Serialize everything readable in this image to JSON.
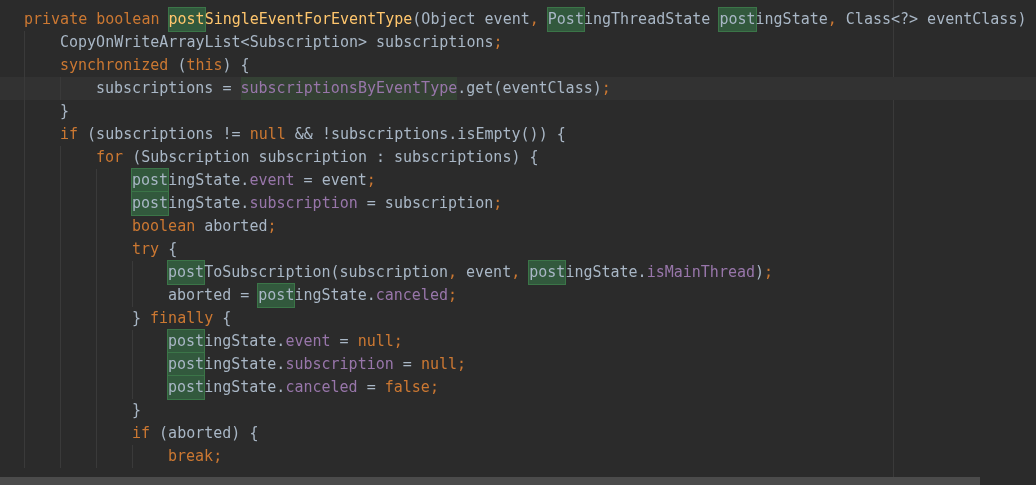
{
  "editor": {
    "lines": [
      {
        "tokens": [
          {
            "text": "private boolean ",
            "kind": "keyword"
          },
          {
            "text": "post",
            "kind": "method",
            "search_match": true
          },
          {
            "text": "SingleEventForEventType",
            "kind": "method"
          },
          {
            "text": "(Object event",
            "kind": "plain"
          },
          {
            "text": ", ",
            "kind": "punct"
          },
          {
            "text": "Post",
            "kind": "plain",
            "search_match": true
          },
          {
            "text": "ingThreadState ",
            "kind": "plain"
          },
          {
            "text": "post",
            "kind": "plain",
            "search_match": true
          },
          {
            "text": "ingState",
            "kind": "plain"
          },
          {
            "text": ", ",
            "kind": "punct"
          },
          {
            "text": "Class<?> eventClass)",
            "kind": "plain"
          }
        ],
        "children": [
          {
            "tokens": [
              {
                "text": "CopyOnWriteArrayList<Subscription> subscriptions",
                "kind": "plain"
              },
              {
                "text": ";",
                "kind": "punct"
              }
            ]
          },
          {
            "tokens": [
              {
                "text": "synchronized ",
                "kind": "keyword"
              },
              {
                "text": "(",
                "kind": "plain"
              },
              {
                "text": "this",
                "kind": "keyword"
              },
              {
                "text": ") {",
                "kind": "plain"
              }
            ],
            "children": [
              {
                "current": true,
                "tokens": [
                  {
                    "text": "subscriptions = ",
                    "kind": "plain"
                  },
                  {
                    "text": "subscriptionsByEventType",
                    "kind": "field",
                    "usage_highlight": true
                  },
                  {
                    "text": ".get(eventClass)",
                    "kind": "plain"
                  },
                  {
                    "text": ";",
                    "kind": "punct"
                  }
                ]
              }
            ]
          },
          {
            "tokens": [
              {
                "text": "}",
                "kind": "plain"
              }
            ]
          },
          {
            "tokens": [
              {
                "text": "if ",
                "kind": "keyword"
              },
              {
                "text": "(subscriptions != ",
                "kind": "plain"
              },
              {
                "text": "null ",
                "kind": "keyword"
              },
              {
                "text": "&& !subscriptions.isEmpty()) {",
                "kind": "plain"
              }
            ],
            "children": [
              {
                "tokens": [
                  {
                    "text": "for ",
                    "kind": "keyword"
                  },
                  {
                    "text": "(Subscription subscription : subscriptions) {",
                    "kind": "plain"
                  }
                ],
                "children": [
                  {
                    "tokens": [
                      {
                        "text": "post",
                        "kind": "plain",
                        "search_match": true
                      },
                      {
                        "text": "ingState.",
                        "kind": "plain"
                      },
                      {
                        "text": "event",
                        "kind": "field"
                      },
                      {
                        "text": " = event",
                        "kind": "plain"
                      },
                      {
                        "text": ";",
                        "kind": "punct"
                      }
                    ]
                  },
                  {
                    "tokens": [
                      {
                        "text": "post",
                        "kind": "plain",
                        "search_match": true
                      },
                      {
                        "text": "ingState.",
                        "kind": "plain"
                      },
                      {
                        "text": "subscription",
                        "kind": "field"
                      },
                      {
                        "text": " = subscription",
                        "kind": "plain"
                      },
                      {
                        "text": ";",
                        "kind": "punct"
                      }
                    ]
                  },
                  {
                    "tokens": [
                      {
                        "text": "boolean ",
                        "kind": "keyword"
                      },
                      {
                        "text": "aborted",
                        "kind": "plain"
                      },
                      {
                        "text": ";",
                        "kind": "punct"
                      }
                    ]
                  },
                  {
                    "tokens": [
                      {
                        "text": "try ",
                        "kind": "keyword"
                      },
                      {
                        "text": "{",
                        "kind": "plain"
                      }
                    ],
                    "children": [
                      {
                        "tokens": [
                          {
                            "text": "post",
                            "kind": "plain",
                            "search_match": true
                          },
                          {
                            "text": "ToSubscription(subscription",
                            "kind": "plain"
                          },
                          {
                            "text": ", ",
                            "kind": "punct"
                          },
                          {
                            "text": "event",
                            "kind": "plain"
                          },
                          {
                            "text": ", ",
                            "kind": "punct"
                          },
                          {
                            "text": "post",
                            "kind": "plain",
                            "search_match": true
                          },
                          {
                            "text": "ingState.",
                            "kind": "plain"
                          },
                          {
                            "text": "isMainThread",
                            "kind": "field"
                          },
                          {
                            "text": ")",
                            "kind": "plain"
                          },
                          {
                            "text": ";",
                            "kind": "punct"
                          }
                        ]
                      },
                      {
                        "tokens": [
                          {
                            "text": "aborted = ",
                            "kind": "plain"
                          },
                          {
                            "text": "post",
                            "kind": "plain",
                            "search_match": true
                          },
                          {
                            "text": "ingState.",
                            "kind": "plain"
                          },
                          {
                            "text": "canceled",
                            "kind": "field"
                          },
                          {
                            "text": ";",
                            "kind": "punct"
                          }
                        ]
                      }
                    ]
                  },
                  {
                    "tokens": [
                      {
                        "text": "} ",
                        "kind": "plain"
                      },
                      {
                        "text": "finally ",
                        "kind": "keyword"
                      },
                      {
                        "text": "{",
                        "kind": "plain"
                      }
                    ],
                    "children": [
                      {
                        "tokens": [
                          {
                            "text": "post",
                            "kind": "plain",
                            "search_match": true
                          },
                          {
                            "text": "ingState.",
                            "kind": "plain"
                          },
                          {
                            "text": "event",
                            "kind": "field"
                          },
                          {
                            "text": " = ",
                            "kind": "plain"
                          },
                          {
                            "text": "null;",
                            "kind": "keyword"
                          }
                        ]
                      },
                      {
                        "tokens": [
                          {
                            "text": "post",
                            "kind": "plain",
                            "search_match": true
                          },
                          {
                            "text": "ingState.",
                            "kind": "plain"
                          },
                          {
                            "text": "subscription",
                            "kind": "field"
                          },
                          {
                            "text": " = ",
                            "kind": "plain"
                          },
                          {
                            "text": "null;",
                            "kind": "keyword"
                          }
                        ]
                      },
                      {
                        "tokens": [
                          {
                            "text": "post",
                            "kind": "plain",
                            "search_match": true
                          },
                          {
                            "text": "ingState.",
                            "kind": "plain"
                          },
                          {
                            "text": "canceled",
                            "kind": "field"
                          },
                          {
                            "text": " = ",
                            "kind": "plain"
                          },
                          {
                            "text": "false;",
                            "kind": "keyword"
                          }
                        ]
                      }
                    ]
                  },
                  {
                    "tokens": [
                      {
                        "text": "}",
                        "kind": "plain"
                      }
                    ]
                  },
                  {
                    "tokens": [
                      {
                        "text": "if ",
                        "kind": "keyword"
                      },
                      {
                        "text": "(aborted) {",
                        "kind": "plain"
                      }
                    ],
                    "children": [
                      {
                        "tokens": [
                          {
                            "text": "break;",
                            "kind": "keyword"
                          }
                        ]
                      }
                    ]
                  }
                ]
              }
            ]
          }
        ]
      }
    ]
  }
}
